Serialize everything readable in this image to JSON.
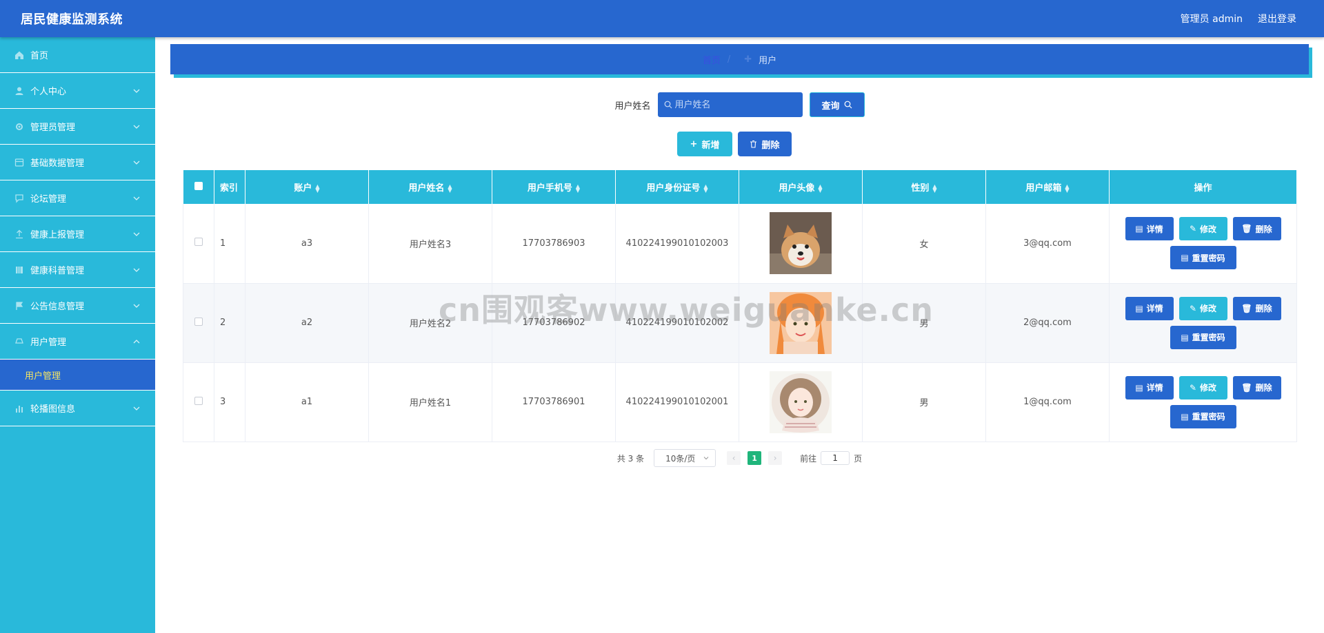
{
  "app": {
    "title": "居民健康监测系统"
  },
  "header": {
    "user_label": "管理员 admin",
    "logout": "退出登录"
  },
  "sidebar": {
    "items": [
      {
        "label": "首页",
        "icon": "home-icon"
      },
      {
        "label": "个人中心",
        "icon": "user-icon"
      },
      {
        "label": "管理员管理",
        "icon": "admin-icon"
      },
      {
        "label": "基础数据管理",
        "icon": "data-icon"
      },
      {
        "label": "论坛管理",
        "icon": "forum-icon"
      },
      {
        "label": "健康上报管理",
        "icon": "upload-icon"
      },
      {
        "label": "健康科普管理",
        "icon": "book-icon"
      },
      {
        "label": "公告信息管理",
        "icon": "flag-icon"
      },
      {
        "label": "用户管理",
        "icon": "users-icon"
      },
      {
        "label": "轮播图信息",
        "icon": "chart-icon"
      }
    ],
    "submenu": {
      "label": "用户管理"
    }
  },
  "breadcrumb": {
    "home": "首页",
    "current": "用户"
  },
  "search": {
    "label": "用户姓名",
    "placeholder": "用户姓名",
    "button": "查询"
  },
  "actions": {
    "add": "新增",
    "delete": "删除"
  },
  "table": {
    "columns": [
      "索引",
      "账户",
      "用户姓名",
      "用户手机号",
      "用户身份证号",
      "用户头像",
      "性别",
      "用户邮箱",
      "操作"
    ],
    "rows": [
      {
        "index": "1",
        "account": "a3",
        "name": "用户姓名3",
        "phone": "17703786903",
        "id_card": "410224199010102003",
        "avatar": "dog-photo",
        "gender": "女",
        "email": "3@qq.com"
      },
      {
        "index": "2",
        "account": "a2",
        "name": "用户姓名2",
        "phone": "17703786902",
        "id_card": "410224199010102002",
        "avatar": "girl-photo",
        "gender": "男",
        "email": "2@qq.com"
      },
      {
        "index": "3",
        "account": "a1",
        "name": "用户姓名1",
        "phone": "17703786901",
        "id_card": "410224199010102001",
        "avatar": "cartoon-girl",
        "gender": "男",
        "email": "1@qq.com"
      }
    ],
    "ops": {
      "detail": "详情",
      "edit": "修改",
      "remove": "删除",
      "reset": "重置密码"
    }
  },
  "pagination": {
    "total": "共 3 条",
    "page_size": "10条/页",
    "current_page": "1",
    "goto_label": "前往",
    "goto_value": "1",
    "page_suffix": "页"
  },
  "watermark": "cn围观客www.weiguanke.cn",
  "colors": {
    "primary": "#2767cf",
    "accent": "#29b9da",
    "active_text": "#f5e663",
    "page_active": "#1fb57b"
  }
}
